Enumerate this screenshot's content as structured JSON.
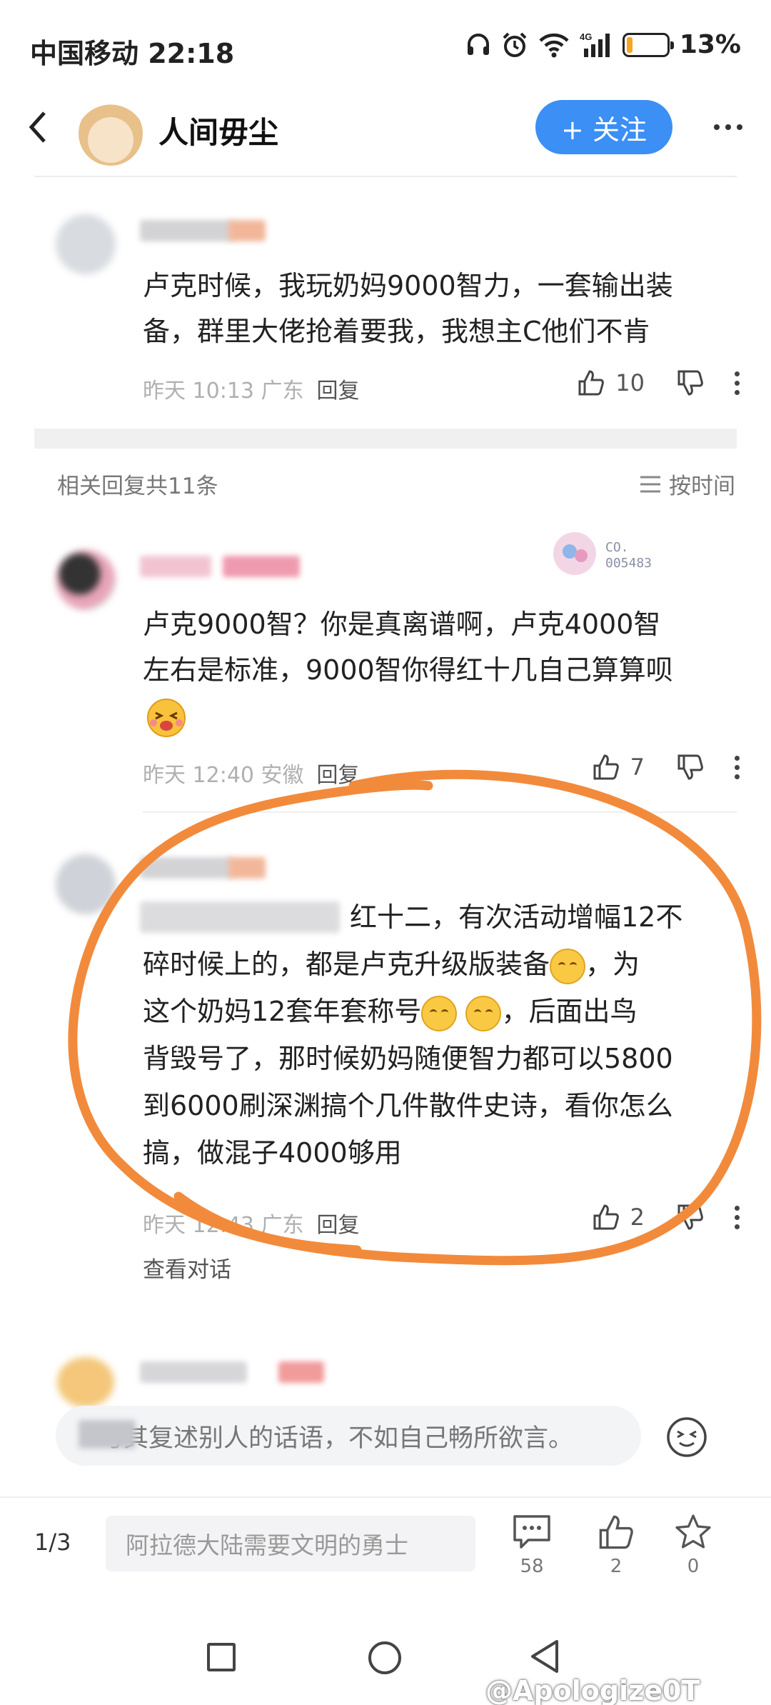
{
  "status_bar": {
    "carrier_time": "中国移动 22:18",
    "battery_percent": "13%",
    "battery_level": 0.13,
    "icons": [
      "headphones-icon",
      "alarm-icon",
      "wifi-icon",
      "signal-4g-icon",
      "battery-icon"
    ]
  },
  "header": {
    "title": "人间毋尘",
    "follow_label": "+ 关注",
    "accent_color": "#3b8ff5"
  },
  "top_comment": {
    "text_line1": "卢克时候，我玩奶妈9000智力，一套输出装",
    "text_line2": "备，群里大佬抢着要我，我想主C他们不肯",
    "meta": "昨天 10:13 广东",
    "reply_label": "回复",
    "likes": "10"
  },
  "related": {
    "count_label": "相关回复共11条",
    "sort_label": "按时间"
  },
  "replies": [
    {
      "badge_text": "CO. 005483",
      "text_line1": "卢克9000智？你是真离谱啊，卢克4000智",
      "text_line2": "左右是标准，9000智你得红十几自己算算呗",
      "meta": "昨天 12:40 安徽",
      "reply_label": "回复",
      "likes": "7"
    },
    {
      "text_line1": "红十二，有次活动增幅12不",
      "text_line2_a": "碎时候上的，都是卢克升级版装备",
      "text_line2_b": "，为",
      "text_line3_a": "这个奶妈12套年套称号",
      "text_line3_b": "，后面出鸟",
      "text_line4": "背毁号了，那时候奶妈随便智力都可以5800",
      "text_line5": "到6000刷深渊搞个几件散件史诗，看你怎么",
      "text_line6": "搞，做混子4000够用",
      "meta": "昨天 12:43 广东",
      "reply_label": "回复",
      "likes": "2",
      "view_conversation": "查看对话"
    }
  ],
  "reply_input": {
    "placeholder": "与其复述别人的话语，不如自己畅所欲言。"
  },
  "bottom_bar": {
    "page_indicator": "1/3",
    "input_placeholder": "阿拉德大陆需要文明的勇士",
    "comments_count": "58",
    "likes_count": "2",
    "favorites_count": "0"
  },
  "watermark": "@Apologize0T"
}
